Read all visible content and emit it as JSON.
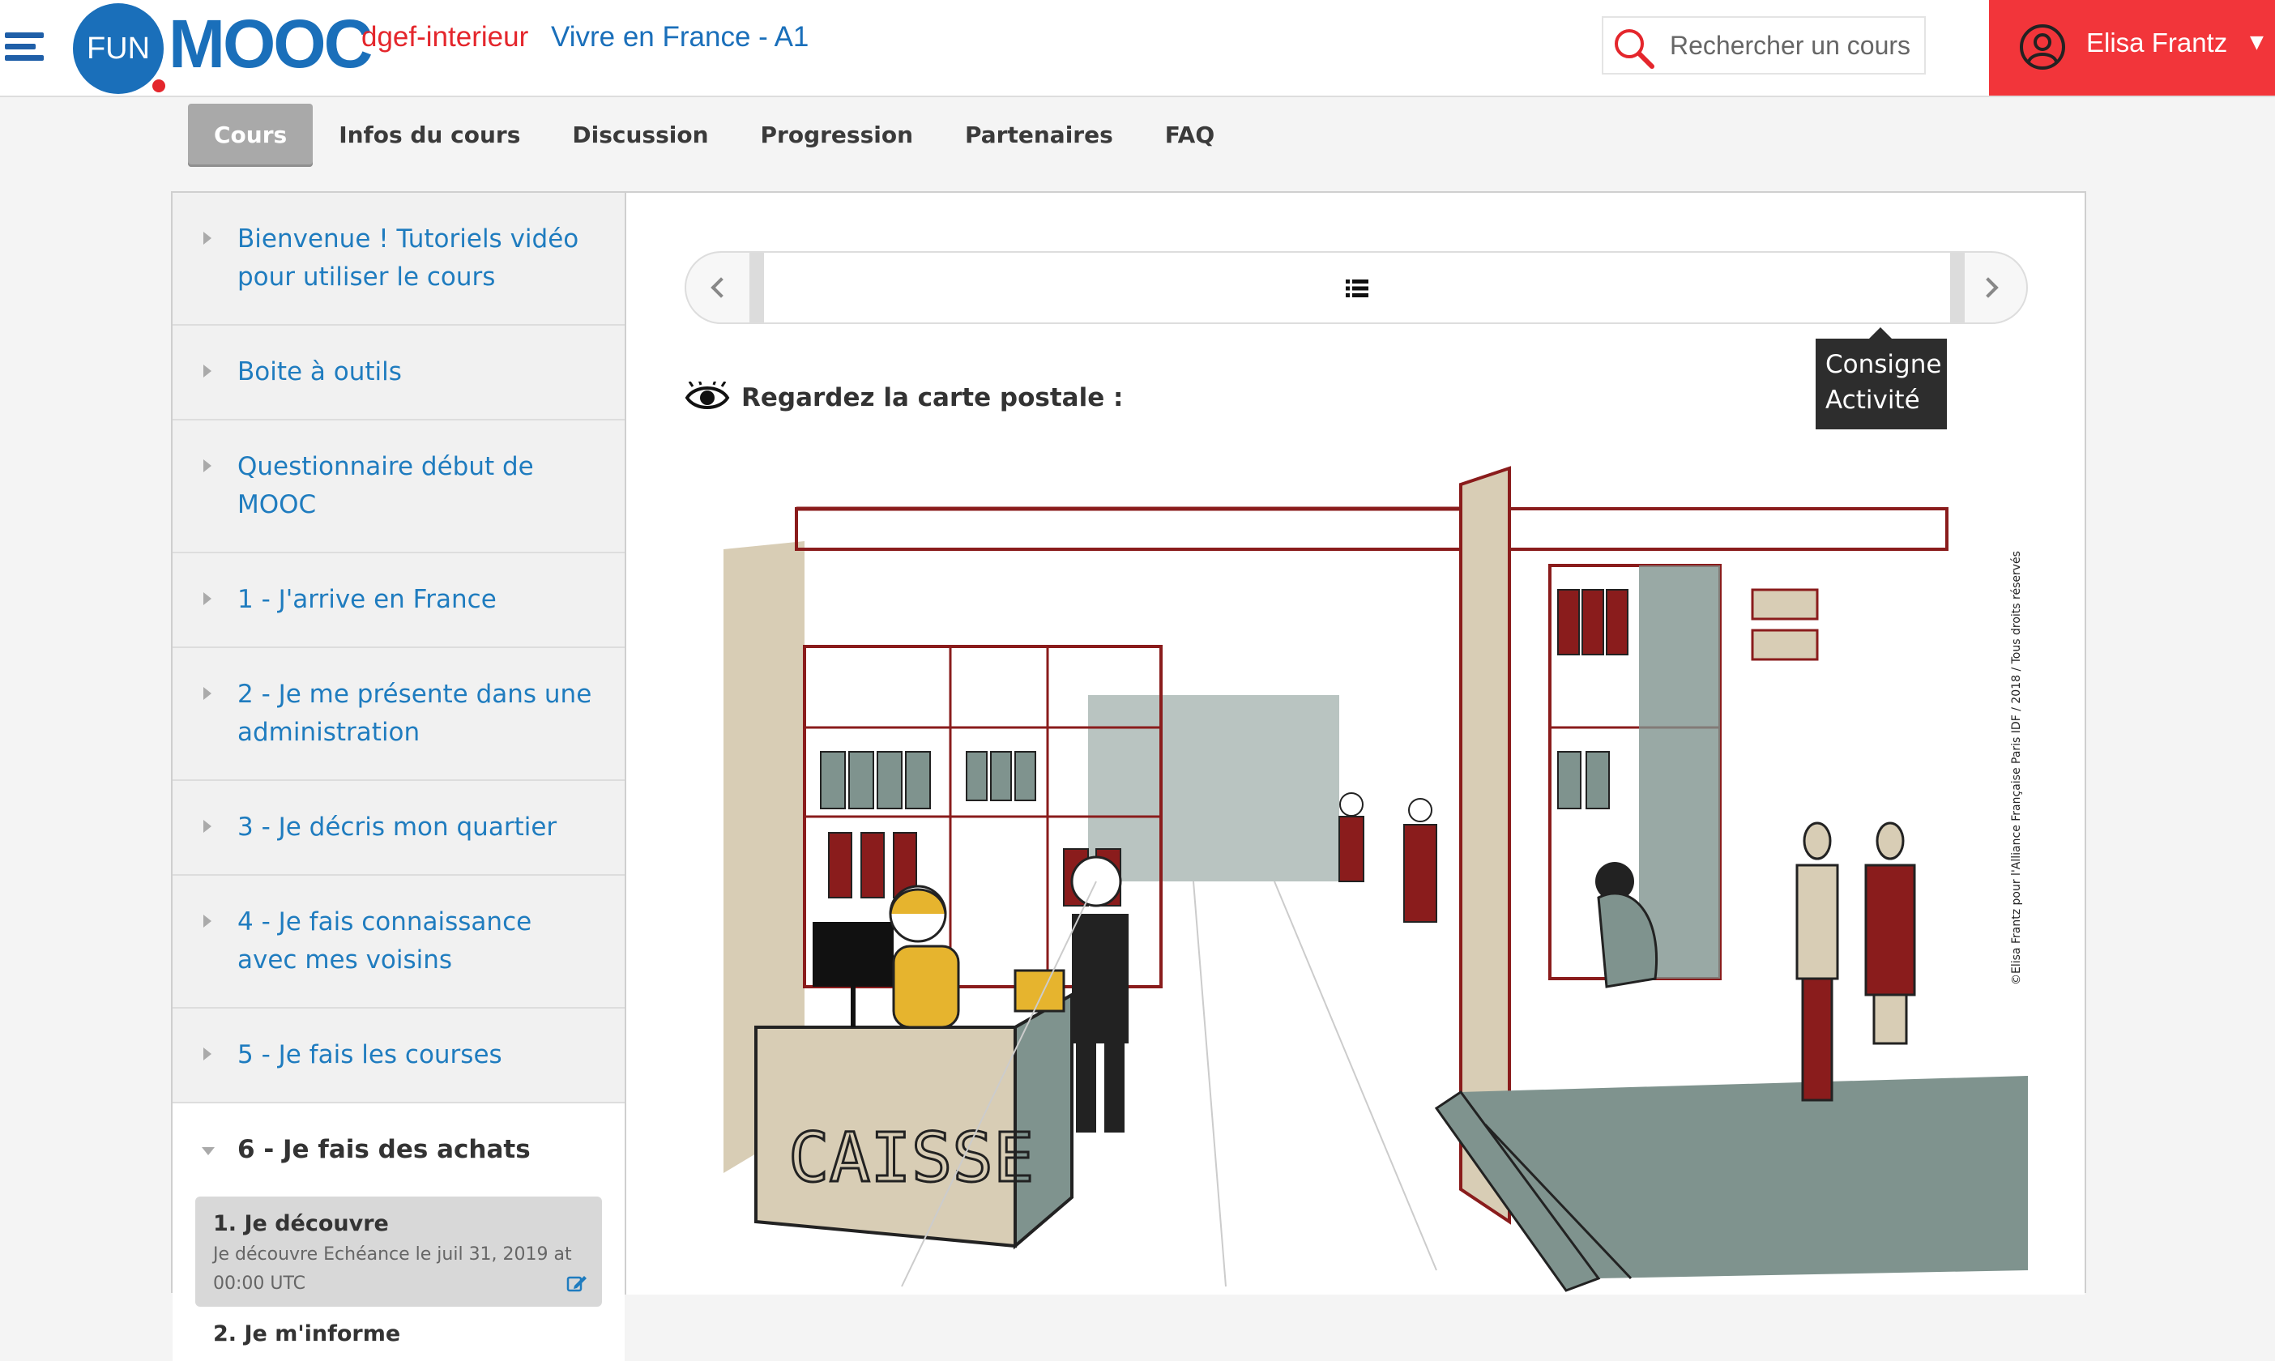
{
  "header": {
    "logo_fun": "FUN",
    "logo_mooc": "MOOC",
    "course_org": "dgef-interieur",
    "course_name": "Vivre en France - A1",
    "search_placeholder": "Rechercher un cours",
    "user_name": "Elisa Frantz",
    "user_caret": "▼"
  },
  "tabs": [
    {
      "label": "Cours",
      "active": true
    },
    {
      "label": "Infos du cours"
    },
    {
      "label": "Discussion"
    },
    {
      "label": "Progression"
    },
    {
      "label": "Partenaires"
    },
    {
      "label": "FAQ"
    }
  ],
  "sidebar": {
    "items": [
      {
        "label": "Bienvenue ! Tutoriels vidéo pour utiliser le cours"
      },
      {
        "label": "Boite à outils"
      },
      {
        "label": "Questionnaire début de MOOC"
      },
      {
        "label": "1 - J'arrive en France"
      },
      {
        "label": "2 - Je me présente dans une administration"
      },
      {
        "label": "3 - Je décris mon quartier"
      },
      {
        "label": "4 - Je fais connaissance avec mes voisins"
      },
      {
        "label": "5 - Je fais les courses"
      },
      {
        "label": "6 - Je fais des achats",
        "open": true
      }
    ],
    "sub_items": [
      {
        "title": "1. Je découvre",
        "description": "Je découvre Echéance le juil 31, 2019 at 00:00 UTC",
        "selected": true
      },
      {
        "title": "2. Je m'informe"
      }
    ]
  },
  "content": {
    "tooltip_line1": "Consigne",
    "tooltip_line2": "Activité",
    "instruction": "Regardez la carte postale :",
    "illustration": {
      "cashier_sign": "CAISSE",
      "credit": "©Elisa Frantz pour l'Alliance Française Paris IDF / 2018 / Tous droits réservés",
      "colors": {
        "line": "#8a1c1c",
        "beige": "#d8cdb5",
        "slate": "#7f938e",
        "dark": "#222222",
        "yellow": "#e6b42e"
      }
    }
  },
  "colors": {
    "brand_blue": "#1a6fba",
    "brand_red": "#e4262c",
    "user_bar": "#f2353a",
    "link": "#1f7cbf",
    "active_tab": "#a9a9a9"
  }
}
